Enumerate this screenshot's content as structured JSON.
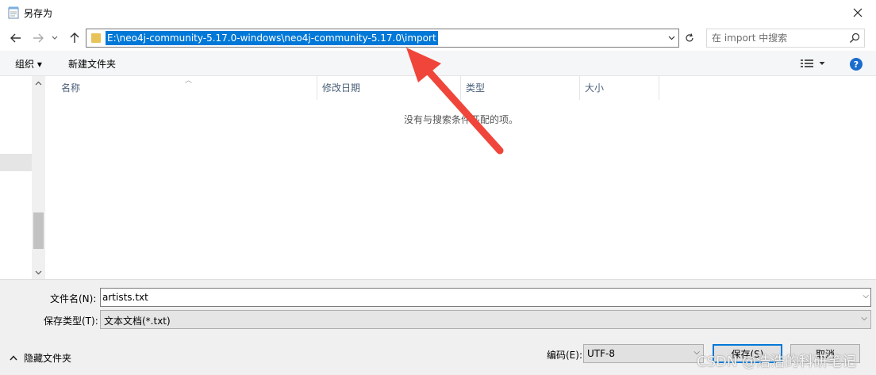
{
  "window": {
    "title": "另存为"
  },
  "nav": {
    "address_path": "E:\\neo4j-community-5.17.0-windows\\neo4j-community-5.17.0\\import",
    "search_placeholder": "在 import 中搜索"
  },
  "toolbar": {
    "organize_label": "组织 ▾",
    "new_folder_label": "新建文件夹"
  },
  "filelist": {
    "columns": [
      "名称",
      "修改日期",
      "类型",
      "大小"
    ],
    "empty_message": "没有与搜索条件匹配的项。"
  },
  "form": {
    "filename_label": "文件名(N):",
    "filename_value": "artists.txt",
    "filetype_label": "保存类型(T):",
    "filetype_value": "文本文档(*.txt)",
    "encoding_label": "编码(E):",
    "encoding_value": "UTF-8"
  },
  "footer": {
    "hide_folders_label": "隐藏文件夹",
    "save_label": "保存(S)",
    "cancel_label": "取消"
  },
  "watermark": "CSDN @浩浩的科研笔记",
  "colors": {
    "selection": "#0078d7",
    "annotation_arrow": "#f0453a",
    "help_icon": "#1a6dcc"
  }
}
